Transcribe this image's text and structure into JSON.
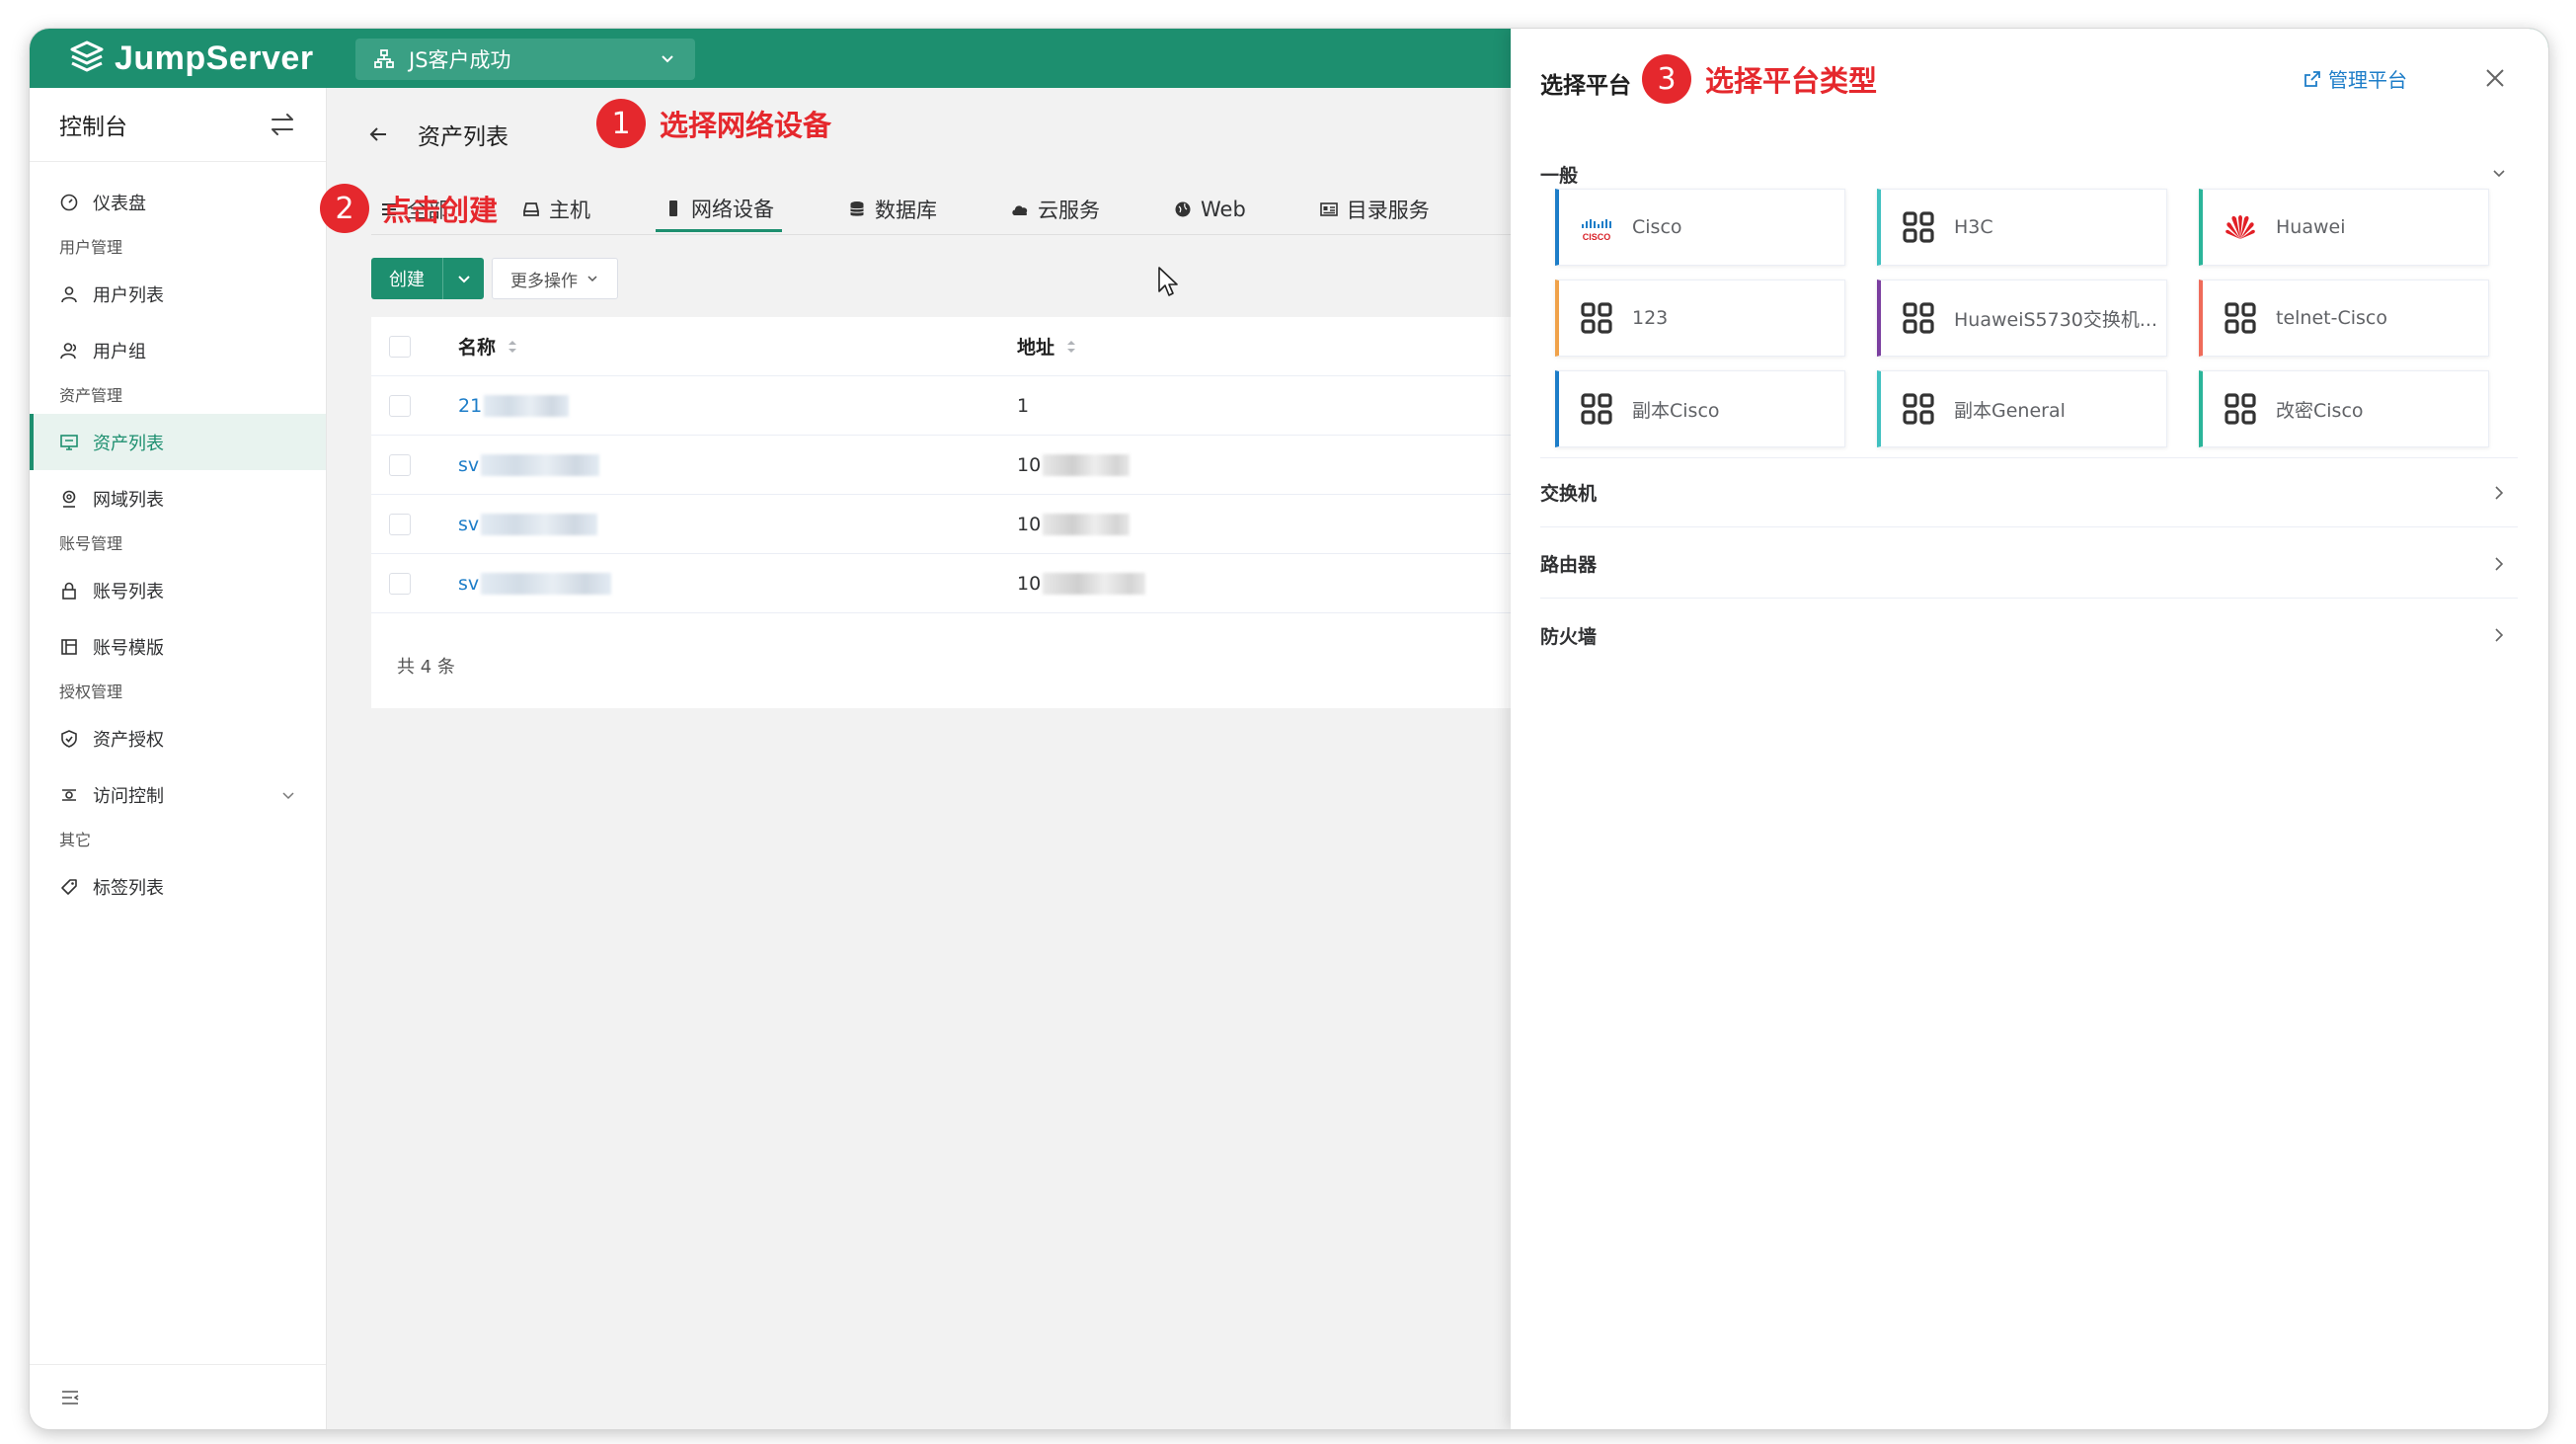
{
  "topbar": {
    "brand": "JumpServer",
    "org": "JS客户成功"
  },
  "sidebar": {
    "title": "控制台",
    "sections": [
      {
        "items": [
          {
            "label": "仪表盘",
            "icon": "dashboard-icon"
          }
        ]
      },
      {
        "group": "用户管理",
        "items": [
          {
            "label": "用户列表",
            "icon": "user-icon"
          },
          {
            "label": "用户组",
            "icon": "user-group-icon"
          }
        ]
      },
      {
        "group": "资产管理",
        "items": [
          {
            "label": "资产列表",
            "icon": "monitor-icon",
            "active": true
          },
          {
            "label": "网域列表",
            "icon": "location-icon"
          }
        ]
      },
      {
        "group": "账号管理",
        "items": [
          {
            "label": "账号列表",
            "icon": "lock-icon"
          },
          {
            "label": "账号模版",
            "icon": "template-icon"
          }
        ]
      },
      {
        "group": "授权管理",
        "items": [
          {
            "label": "资产授权",
            "icon": "shield-icon"
          },
          {
            "label": "访问控制",
            "icon": "access-control-icon"
          }
        ]
      },
      {
        "group": "其它",
        "items": [
          {
            "label": "标签列表",
            "icon": "tag-icon"
          }
        ]
      }
    ]
  },
  "page": {
    "title": "资产列表"
  },
  "tabs": [
    {
      "label": "全部",
      "icon": "list-icon"
    },
    {
      "label": "主机",
      "icon": "host-icon"
    },
    {
      "label": "网络设备",
      "icon": "device-icon",
      "active": true
    },
    {
      "label": "数据库",
      "icon": "database-icon"
    },
    {
      "label": "云服务",
      "icon": "cloud-icon"
    },
    {
      "label": "Web",
      "icon": "globe-icon"
    },
    {
      "label": "目录服务",
      "icon": "directory-icon"
    }
  ],
  "toolbar": {
    "create": "创建",
    "more": "更多操作"
  },
  "table": {
    "columns": {
      "name": "名称",
      "address": "地址"
    },
    "rows": [
      {
        "name": "21",
        "address": "1"
      },
      {
        "name": "sv",
        "address": "10"
      },
      {
        "name": "sv",
        "address": "10"
      },
      {
        "name": "sv",
        "address": "10"
      }
    ],
    "total": "共 4 条"
  },
  "annotations": {
    "a1": {
      "num": "1",
      "text": "选择网络设备"
    },
    "a2": {
      "num": "2",
      "text": "点击创建"
    },
    "a3": {
      "num": "3",
      "text": "选择平台类型"
    }
  },
  "drawer": {
    "title": "选择平台",
    "manage": "管理平台",
    "sections": {
      "general": "一般",
      "switch": "交换机",
      "router": "路由器",
      "firewall": "防火墙"
    },
    "platforms": [
      {
        "label": "Cisco",
        "icon": "cisco-logo",
        "color": "#1d7dc8"
      },
      {
        "label": "H3C",
        "icon": "grid-icon",
        "color": "#40c0c0"
      },
      {
        "label": "Huawei",
        "icon": "huawei-logo",
        "color": "#2ab59a"
      },
      {
        "label": "123",
        "icon": "grid-icon",
        "color": "#f0a24a"
      },
      {
        "label": "HuaweiS5730交换机...",
        "icon": "grid-icon",
        "color": "#7b3fa0"
      },
      {
        "label": "telnet-Cisco",
        "icon": "grid-icon",
        "color": "#ef6b5a"
      },
      {
        "label": "副本Cisco",
        "icon": "grid-icon",
        "color": "#1d7dc8"
      },
      {
        "label": "副本General",
        "icon": "grid-icon",
        "color": "#40c0c0"
      },
      {
        "label": "改密Cisco",
        "icon": "grid-icon",
        "color": "#2ab59a"
      }
    ]
  },
  "colors": {
    "primary": "#1d8f6f",
    "link": "#1d7dc8",
    "annotation": "#e5282d"
  }
}
